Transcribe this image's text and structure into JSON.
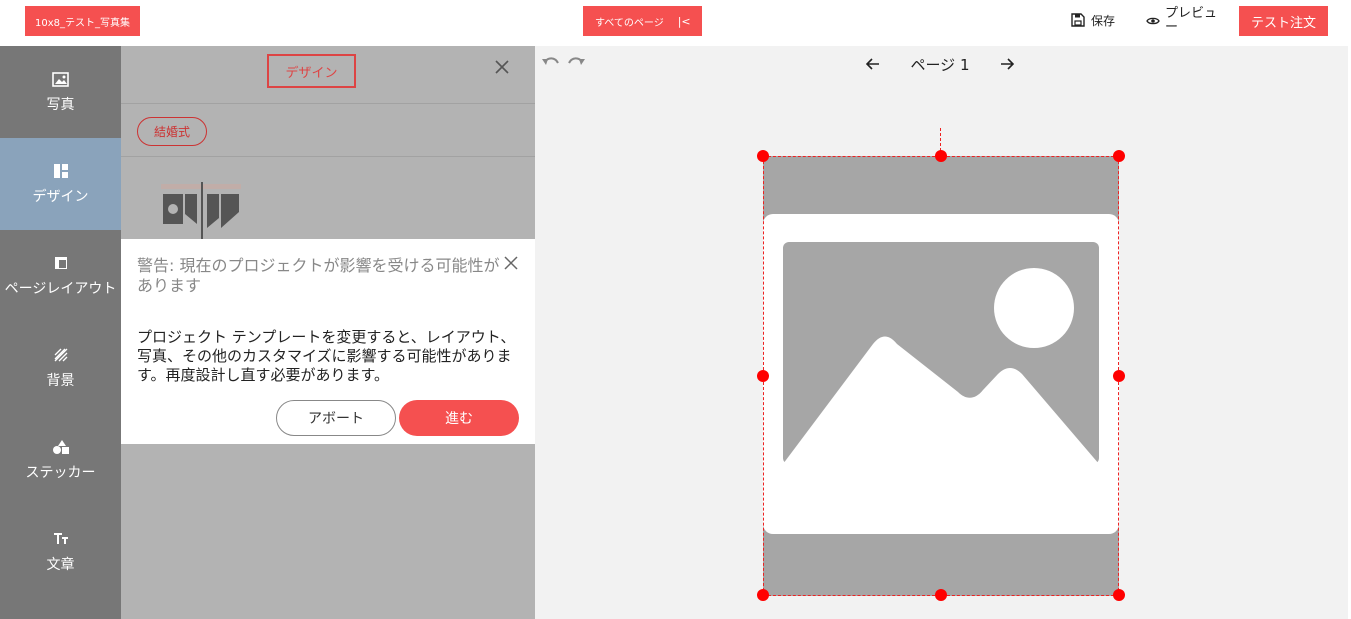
{
  "header": {
    "project_name": "10x8_テスト_写真集",
    "all_pages_label": "すべてのページ",
    "collapse_symbol": "|<",
    "save_label": "保存",
    "preview_label": "プレビュー",
    "order_label": "テスト注文"
  },
  "sidebar": {
    "items": [
      {
        "label": "写真",
        "icon": "image-icon"
      },
      {
        "label": "デザイン",
        "icon": "design-layout-icon",
        "active": true
      },
      {
        "label": "ページレイアウト",
        "icon": "page-layout-icon"
      },
      {
        "label": "背景",
        "icon": "background-pattern-icon"
      },
      {
        "label": "ステッカー",
        "icon": "shapes-icon"
      },
      {
        "label": "文章",
        "icon": "text-icon"
      }
    ],
    "active_color": "#8aa3bb"
  },
  "panel": {
    "tab_label": "デザイン",
    "category_chip": "結婚式"
  },
  "dialog": {
    "title": "警告: 現在のプロジェクトが影響を受ける可能性があります",
    "body": "プロジェクト テンプレートを変更すると、レイアウト、写真、その他のカスタマイズに影響する可能性があります。再度設計し直す必要があります。",
    "abort_label": "アボート",
    "proceed_label": "進む"
  },
  "canvas": {
    "page_label": "ページ 1"
  },
  "colors": {
    "accent": "#f55050",
    "selection": "#ff0000"
  }
}
